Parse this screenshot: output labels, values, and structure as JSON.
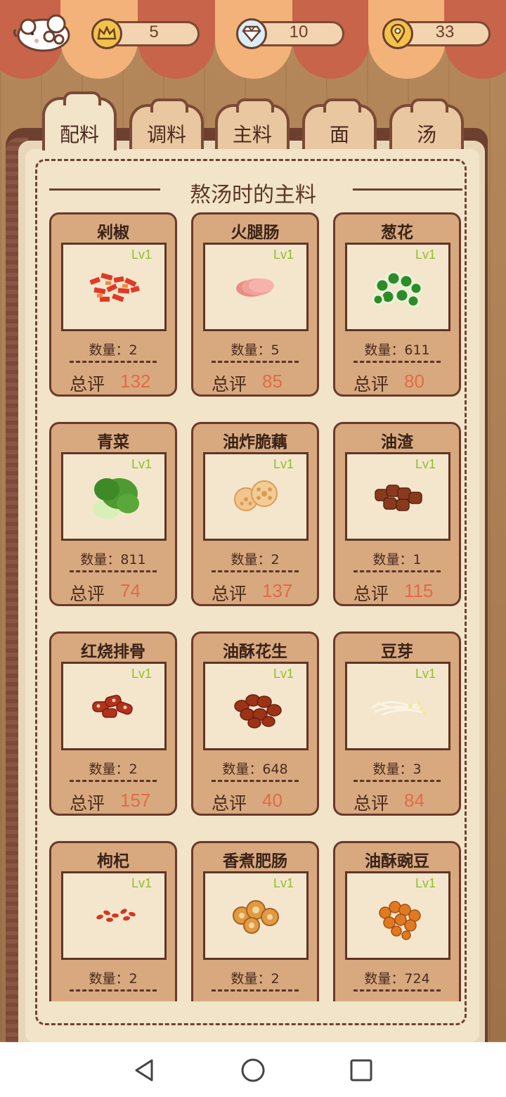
{
  "topbar": {
    "crowns": "5",
    "gems": "10",
    "pins": "33"
  },
  "tabs": [
    {
      "label": "配料",
      "active": true
    },
    {
      "label": "调料",
      "active": false
    },
    {
      "label": "主料",
      "active": false
    },
    {
      "label": "面",
      "active": false
    },
    {
      "label": "汤",
      "active": false
    }
  ],
  "section_title": "熬汤时的主料",
  "labels": {
    "level": "Lv1",
    "qty_prefix": "数量：",
    "score_prefix": "总评"
  },
  "items": [
    {
      "name": "剁椒",
      "qty": "2",
      "score": "132",
      "icon": "chopped-chili-icon"
    },
    {
      "name": "火腿肠",
      "qty": "5",
      "score": "85",
      "icon": "ham-sausage-icon"
    },
    {
      "name": "葱花",
      "qty": "611",
      "score": "80",
      "icon": "scallion-icon"
    },
    {
      "name": "青菜",
      "qty": "811",
      "score": "74",
      "icon": "bok-choy-icon"
    },
    {
      "name": "油炸脆藕",
      "qty": "2",
      "score": "137",
      "icon": "fried-lotus-root-icon"
    },
    {
      "name": "油渣",
      "qty": "1",
      "score": "115",
      "icon": "pork-crackling-icon"
    },
    {
      "name": "红烧排骨",
      "qty": "2",
      "score": "157",
      "icon": "braised-ribs-icon"
    },
    {
      "name": "油酥花生",
      "qty": "648",
      "score": "40",
      "icon": "fried-peanuts-icon"
    },
    {
      "name": "豆芽",
      "qty": "3",
      "score": "84",
      "icon": "bean-sprouts-icon"
    },
    {
      "name": "枸杞",
      "qty": "2",
      "score": "",
      "icon": "goji-berry-icon"
    },
    {
      "name": "香煮肥肠",
      "qty": "2",
      "score": "",
      "icon": "pork-intestine-icon"
    },
    {
      "name": "油酥豌豆",
      "qty": "724",
      "score": "",
      "icon": "fried-peas-icon"
    }
  ],
  "colors": {
    "awning_dark": "#c7644a",
    "awning_light": "#f2b279",
    "card_bg": "#d8a97f",
    "score_text": "#e26a4a",
    "level_text": "#8fbf2a"
  }
}
